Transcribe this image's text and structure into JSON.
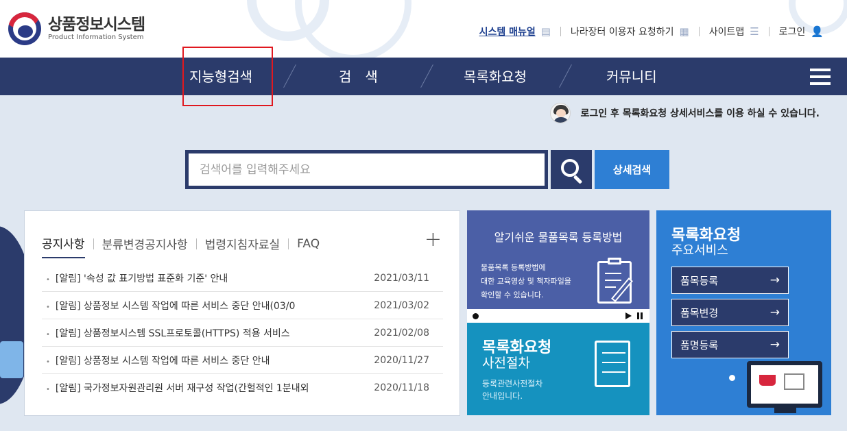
{
  "logo": {
    "title_ko": "상품정보시스템",
    "title_en": "Product Information System"
  },
  "util": {
    "manual": "시스템 매뉴얼",
    "request": "나라장터 이용자 요청하기",
    "sitemap": "사이트맵",
    "login": "로그인"
  },
  "nav": {
    "items": [
      "지능형검색",
      "검　색",
      "목록화요청",
      "커뮤니티"
    ]
  },
  "notice_bar": {
    "text": "로그인 후 목록화요청 상세서비스를 이용 하실 수 있습니다."
  },
  "search": {
    "placeholder": "검색어를 입력해주세요",
    "value": "",
    "detail_label": "상세검색"
  },
  "notice_panel": {
    "tabs": [
      "공지사항",
      "분류변경공지사항",
      "법령지침자료실",
      "FAQ"
    ],
    "plus": "+",
    "items": [
      {
        "title": "[알림] '속성 값 표기방법 표준화 기준' 안내",
        "date": "2021/03/11"
      },
      {
        "title": "[알림] 상품정보 시스템 작업에 따른 서비스 중단 안내(03/0",
        "date": "2021/03/02"
      },
      {
        "title": "[알림] 상품정보시스템 SSL프로토콜(HTTPS) 적용 서비스",
        "date": "2021/02/08"
      },
      {
        "title": "[알림] 상품정보 시스템 작업에 따른 서비스 중단 안내",
        "date": "2020/11/27"
      },
      {
        "title": "[알림] 국가정보자원관리원 서버 재구성 작업(간헐적인 1분내외",
        "date": "2020/11/18"
      }
    ]
  },
  "card1": {
    "title": "알기쉬운 물품목록 등록방법",
    "desc": [
      "물품목록 등록방법에",
      "대한 교육영상 및 책자파일을",
      "확인할 수 있습니다."
    ]
  },
  "card2": {
    "title": "목록화요청",
    "sub": "사전절차",
    "desc": [
      "등록관련사전절차",
      "안내입니다."
    ]
  },
  "card3": {
    "title": "목록화요청",
    "sub": "주요서비스",
    "services": [
      "품목등록",
      "품목변경",
      "품명등록"
    ],
    "arrow": "→"
  },
  "colors": {
    "navy": "#2b3b6b",
    "blue": "#2e7fd4",
    "teal": "#1592bf",
    "highlight": "#e0181f"
  }
}
